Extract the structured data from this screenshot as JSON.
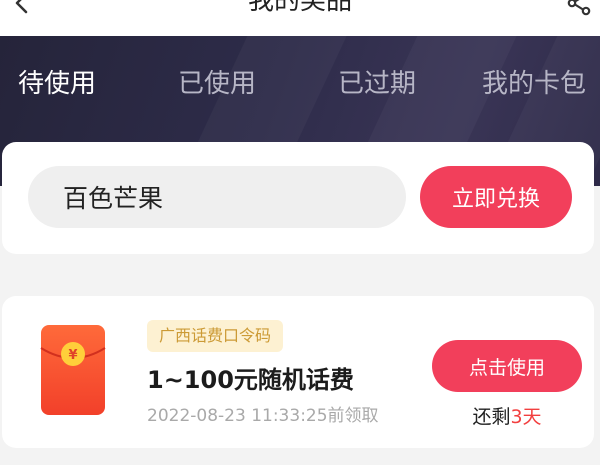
{
  "header": {
    "title": "我的奖品",
    "tabs": [
      {
        "label": "待使用",
        "active": true
      },
      {
        "label": "已使用",
        "active": false
      },
      {
        "label": "已过期",
        "active": false
      },
      {
        "label": "我的卡包",
        "active": false
      }
    ]
  },
  "icons": {
    "back": "chevron-left-icon",
    "share": "share-icon",
    "prize": "red-envelope-icon"
  },
  "redeem": {
    "code_value": "百色芒果",
    "button_label": "立即兑换"
  },
  "prize": {
    "tag": "广西话费口令码",
    "title": "1~100元随机话费",
    "received_time": "2022-08-23 11:33:25前领取",
    "button_label": "点击使用",
    "remaining_prefix": "还剩",
    "remaining_days": "3天"
  },
  "colors": {
    "accent": "#f23f5b",
    "header_bg": "#2b2942",
    "tag_bg": "#fdf1d2",
    "tag_text": "#cc9a35"
  }
}
